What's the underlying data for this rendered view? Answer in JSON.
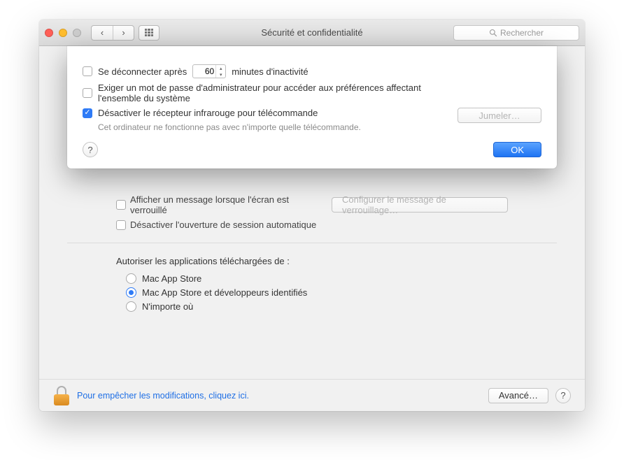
{
  "window": {
    "title": "Sécurité et confidentialité",
    "search_placeholder": "Rechercher"
  },
  "sheet": {
    "logout_after_label_pre": "Se déconnecter après",
    "logout_minutes": "60",
    "logout_after_label_post": "minutes d'inactivité",
    "logout_checked": false,
    "admin_pwd_label": "Exiger un mot de passe d'administrateur pour accéder aux préférences affectant l'ensemble du système",
    "admin_pwd_checked": false,
    "ir_disable_label": "Désactiver le récepteur infrarouge pour télécommande",
    "ir_disable_checked": true,
    "ir_sub": "Cet ordinateur ne fonctionne pas avec n'importe quelle télécommande.",
    "pair_button": "Jumeler…",
    "ok_button": "OK"
  },
  "background": {
    "lock_msg_label": "Afficher un message lorsque l'écran est verrouillé",
    "lock_msg_checked": false,
    "set_lock_msg_button": "Configurer le message de verrouillage…",
    "auto_login_label": "Désactiver l'ouverture de session automatique",
    "auto_login_checked": false,
    "gatekeeper_header": "Autoriser les applications téléchargées de :",
    "gk_options": [
      {
        "label": "Mac App Store",
        "checked": false
      },
      {
        "label": "Mac App Store et développeurs identifiés",
        "checked": true
      },
      {
        "label": "N'importe où",
        "checked": false
      }
    ]
  },
  "footer": {
    "lock_text": "Pour empêcher les modifications, cliquez ici.",
    "advanced_button": "Avancé…"
  }
}
